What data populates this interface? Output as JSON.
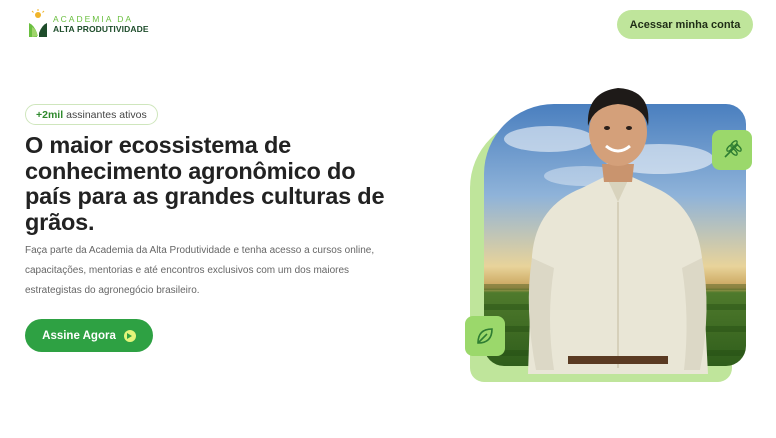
{
  "header": {
    "logo_line1": "ACADEMIA DA",
    "logo_line2": "ALTA PRODUTIVIDADE",
    "login_label": "Acessar minha conta"
  },
  "hero": {
    "badge_strong": "+2mil",
    "badge_text": "assinantes ativos",
    "headline": "O maior ecossistema de conhecimento agronômico do país para as grandes culturas de grãos.",
    "description": "Faça parte da Academia da Alta Produtividade e tenha acesso a cursos online, capacitações, mentorias e até encontros exclusivos com um dos maiores estrategistas do agronegócio brasileiro.",
    "cta_label": "Assine Agora"
  },
  "icons": {
    "cta_icon": "arrow-right-circle-icon",
    "top_badge_icon": "wheat-icon",
    "bottom_badge_icon": "leaf-icon"
  },
  "colors": {
    "brand_green": "#2ea143",
    "light_green": "#bfe59b",
    "badge_green": "#9bd86b",
    "text_dark": "#222222"
  }
}
